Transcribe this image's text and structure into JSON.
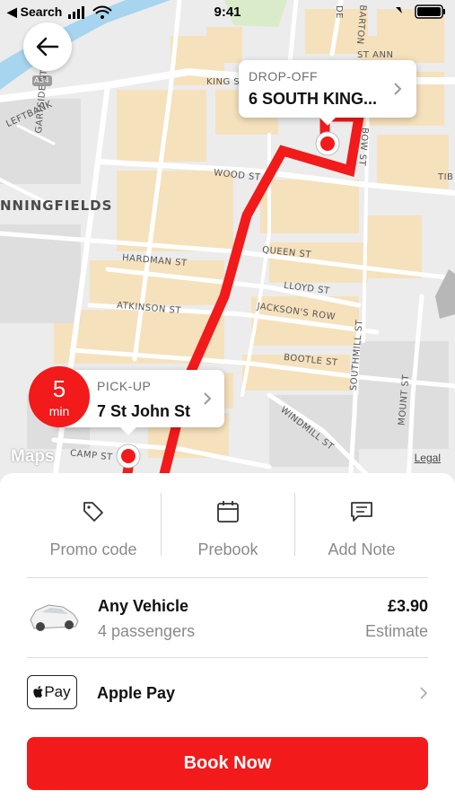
{
  "status_bar": {
    "back_app": "◀ Search",
    "time": "9:41"
  },
  "map": {
    "district": "NNINGFIELDS",
    "streets": [
      "KING ST",
      "ST ANN",
      "DE",
      "BARTON",
      "GARTSIDE ST",
      "LEFTBANK",
      "WOOD ST",
      "BOW ST",
      "QUEEN ST",
      "HARDMAN ST",
      "LLOYD ST",
      "ATKINSON ST",
      "JACKSON'S ROW",
      "BOOTLE ST",
      "SOUTHMILL ST",
      "MOUNT ST",
      "WINDMILL ST",
      "CAMP ST",
      "TIB",
      "A34"
    ],
    "maps_logo": "Maps",
    "legal": "Legal",
    "route_color": "#f21a1a"
  },
  "dropoff": {
    "label": "DROP-OFF",
    "value": "6 SOUTH KING..."
  },
  "pickup": {
    "label": "PICK-UP",
    "value": "7 St John St",
    "eta_value": "5",
    "eta_unit": "min"
  },
  "options": [
    {
      "label": "Promo code",
      "icon": "tag-icon"
    },
    {
      "label": "Prebook",
      "icon": "calendar-icon"
    },
    {
      "label": "Add Note",
      "icon": "note-icon"
    }
  ],
  "vehicle": {
    "name": "Any Vehicle",
    "passengers": "4 passengers",
    "price": "£3.90",
    "price_note": "Estimate"
  },
  "payment": {
    "badge": "Pay",
    "method": "Apple Pay"
  },
  "book_button": "Book Now",
  "accent_color": "#f21a1a"
}
